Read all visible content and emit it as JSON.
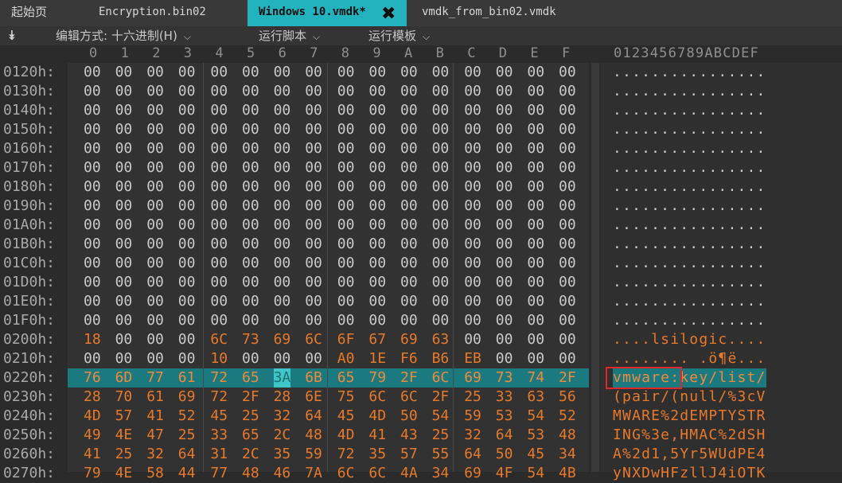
{
  "tabs": {
    "home": "起始页",
    "file1": "Encryption.bin02",
    "active": "Windows 10.vmdk*",
    "file3": "vmdk_from_bin02.vmdk",
    "close_glyph": "✖"
  },
  "toolbar": {
    "menu_glyph": "⯯",
    "edit_mode": "编辑方式: 十六进制(H)",
    "run_script": "运行脚本",
    "run_template": "运行模板",
    "chevron": "⌵"
  },
  "columns": [
    "0",
    "1",
    "2",
    "3",
    "4",
    "5",
    "6",
    "7",
    "8",
    "9",
    "A",
    "B",
    "C",
    "D",
    "E",
    "F"
  ],
  "ascii_header": "0123456789ABCDEF",
  "rows": [
    {
      "offset": "0120h:",
      "bytes": [
        "00",
        "00",
        "00",
        "00",
        "00",
        "00",
        "00",
        "00",
        "00",
        "00",
        "00",
        "00",
        "00",
        "00",
        "00",
        "00"
      ],
      "ascii": "................"
    },
    {
      "offset": "0130h:",
      "bytes": [
        "00",
        "00",
        "00",
        "00",
        "00",
        "00",
        "00",
        "00",
        "00",
        "00",
        "00",
        "00",
        "00",
        "00",
        "00",
        "00"
      ],
      "ascii": "................"
    },
    {
      "offset": "0140h:",
      "bytes": [
        "00",
        "00",
        "00",
        "00",
        "00",
        "00",
        "00",
        "00",
        "00",
        "00",
        "00",
        "00",
        "00",
        "00",
        "00",
        "00"
      ],
      "ascii": "................"
    },
    {
      "offset": "0150h:",
      "bytes": [
        "00",
        "00",
        "00",
        "00",
        "00",
        "00",
        "00",
        "00",
        "00",
        "00",
        "00",
        "00",
        "00",
        "00",
        "00",
        "00"
      ],
      "ascii": "................"
    },
    {
      "offset": "0160h:",
      "bytes": [
        "00",
        "00",
        "00",
        "00",
        "00",
        "00",
        "00",
        "00",
        "00",
        "00",
        "00",
        "00",
        "00",
        "00",
        "00",
        "00"
      ],
      "ascii": "................"
    },
    {
      "offset": "0170h:",
      "bytes": [
        "00",
        "00",
        "00",
        "00",
        "00",
        "00",
        "00",
        "00",
        "00",
        "00",
        "00",
        "00",
        "00",
        "00",
        "00",
        "00"
      ],
      "ascii": "................"
    },
    {
      "offset": "0180h:",
      "bytes": [
        "00",
        "00",
        "00",
        "00",
        "00",
        "00",
        "00",
        "00",
        "00",
        "00",
        "00",
        "00",
        "00",
        "00",
        "00",
        "00"
      ],
      "ascii": "................"
    },
    {
      "offset": "0190h:",
      "bytes": [
        "00",
        "00",
        "00",
        "00",
        "00",
        "00",
        "00",
        "00",
        "00",
        "00",
        "00",
        "00",
        "00",
        "00",
        "00",
        "00"
      ],
      "ascii": "................"
    },
    {
      "offset": "01A0h:",
      "bytes": [
        "00",
        "00",
        "00",
        "00",
        "00",
        "00",
        "00",
        "00",
        "00",
        "00",
        "00",
        "00",
        "00",
        "00",
        "00",
        "00"
      ],
      "ascii": "................"
    },
    {
      "offset": "01B0h:",
      "bytes": [
        "00",
        "00",
        "00",
        "00",
        "00",
        "00",
        "00",
        "00",
        "00",
        "00",
        "00",
        "00",
        "00",
        "00",
        "00",
        "00"
      ],
      "ascii": "................"
    },
    {
      "offset": "01C0h:",
      "bytes": [
        "00",
        "00",
        "00",
        "00",
        "00",
        "00",
        "00",
        "00",
        "00",
        "00",
        "00",
        "00",
        "00",
        "00",
        "00",
        "00"
      ],
      "ascii": "................"
    },
    {
      "offset": "01D0h:",
      "bytes": [
        "00",
        "00",
        "00",
        "00",
        "00",
        "00",
        "00",
        "00",
        "00",
        "00",
        "00",
        "00",
        "00",
        "00",
        "00",
        "00"
      ],
      "ascii": "................"
    },
    {
      "offset": "01E0h:",
      "bytes": [
        "00",
        "00",
        "00",
        "00",
        "00",
        "00",
        "00",
        "00",
        "00",
        "00",
        "00",
        "00",
        "00",
        "00",
        "00",
        "00"
      ],
      "ascii": "................"
    },
    {
      "offset": "01F0h:",
      "bytes": [
        "00",
        "00",
        "00",
        "00",
        "00",
        "00",
        "00",
        "00",
        "00",
        "00",
        "00",
        "00",
        "00",
        "00",
        "00",
        "00"
      ],
      "ascii": "................"
    },
    {
      "offset": "0200h:",
      "bytes": [
        "18",
        "00",
        "00",
        "00",
        "6C",
        "73",
        "69",
        "6C",
        "6F",
        "67",
        "69",
        "63",
        "00",
        "00",
        "00",
        "00"
      ],
      "ascii": "....lsilogic...."
    },
    {
      "offset": "0210h:",
      "bytes": [
        "00",
        "00",
        "00",
        "00",
        "10",
        "00",
        "00",
        "00",
        "A0",
        "1E",
        "F6",
        "B6",
        "EB",
        "00",
        "00",
        "00"
      ],
      "ascii": "........ .ö¶ë..."
    },
    {
      "offset": "0220h:",
      "bytes": [
        "76",
        "6D",
        "77",
        "61",
        "72",
        "65",
        "3A",
        "6B",
        "65",
        "79",
        "2F",
        "6C",
        "69",
        "73",
        "74",
        "2F"
      ],
      "ascii": "vmware:key/list/",
      "highlight": true,
      "selected_byte": 6
    },
    {
      "offset": "0230h:",
      "bytes": [
        "28",
        "70",
        "61",
        "69",
        "72",
        "2F",
        "28",
        "6E",
        "75",
        "6C",
        "6C",
        "2F",
        "25",
        "33",
        "63",
        "56"
      ],
      "ascii": "(pair/(null/%3cV"
    },
    {
      "offset": "0240h:",
      "bytes": [
        "4D",
        "57",
        "41",
        "52",
        "45",
        "25",
        "32",
        "64",
        "45",
        "4D",
        "50",
        "54",
        "59",
        "53",
        "54",
        "52"
      ],
      "ascii": "MWARE%2dEMPTYSTR"
    },
    {
      "offset": "0250h:",
      "bytes": [
        "49",
        "4E",
        "47",
        "25",
        "33",
        "65",
        "2C",
        "48",
        "4D",
        "41",
        "43",
        "25",
        "32",
        "64",
        "53",
        "48"
      ],
      "ascii": "ING%3e,HMAC%2dSH"
    },
    {
      "offset": "0260h:",
      "bytes": [
        "41",
        "25",
        "32",
        "64",
        "31",
        "2C",
        "35",
        "59",
        "72",
        "35",
        "57",
        "55",
        "64",
        "50",
        "45",
        "34"
      ],
      "ascii": "A%2d1,5Yr5WUdPE4"
    },
    {
      "offset": "0270h:",
      "bytes": [
        "79",
        "4E",
        "58",
        "44",
        "77",
        "48",
        "46",
        "7A",
        "6C",
        "6C",
        "4A",
        "34",
        "69",
        "4F",
        "54",
        "4B"
      ],
      "ascii": "yNXDwHFzllJ4iOTK"
    }
  ],
  "colors": {
    "background": "#2b2b2b",
    "tab_active": "#22b3bf",
    "data_bytes": "#e8792a",
    "zero_bytes": "#c9c9c9",
    "highlight_row": "#1b7a80",
    "selection_box": "#e0262a"
  }
}
